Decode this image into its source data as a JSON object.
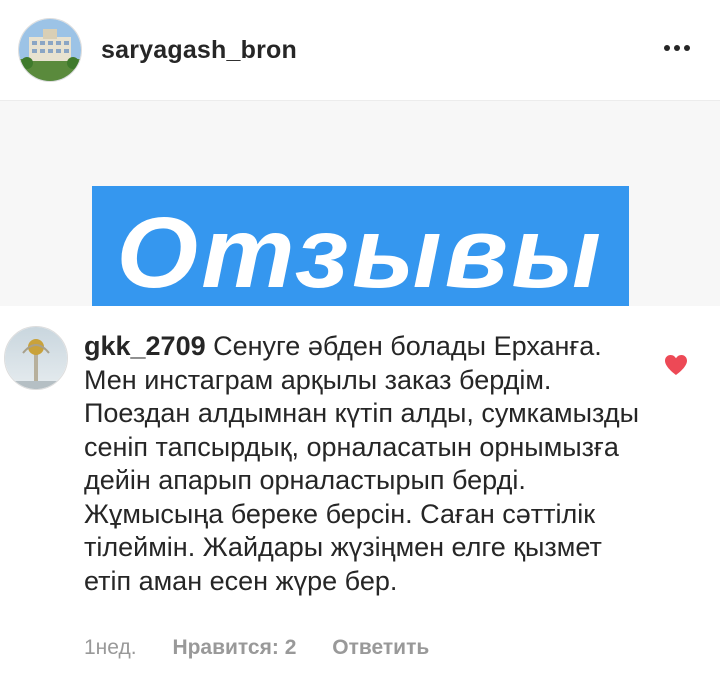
{
  "post": {
    "username": "saryagash_bron",
    "banner_text": "Отзывы"
  },
  "comment": {
    "username": "gkk_2709",
    "text": "Сенуге әбден болады Ерханға. Мен инстаграм арқылы заказ бердім. Поездан алдымнан күтіп алды, сумкамызды сеніп тапсырдық, орналасатын орнымызға дейін апарып орналастырып берді. Жұмысыңа береке берсін. Саған сәттілік тілеймін. Жайдары жүзіңмен елге қызмет етіп аман есен жүре бер.",
    "time": "1нед.",
    "likes_label": "Нравится: 2",
    "reply_label": "Ответить",
    "liked": true
  },
  "icons": {
    "more": "more-horizontal-icon",
    "heart": "heart-icon"
  },
  "colors": {
    "banner": "#3597ef",
    "heart": "#ed4956",
    "meta": "#999999"
  }
}
